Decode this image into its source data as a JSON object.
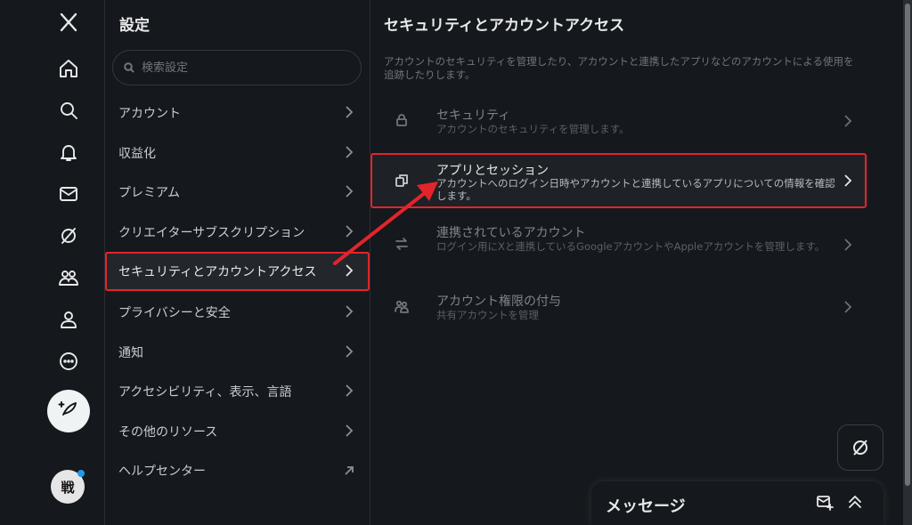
{
  "icons": {
    "logo": "x-logo-icon",
    "nav": [
      "home-icon",
      "search-icon",
      "bell-icon",
      "mail-icon",
      "grok-icon",
      "communities-icon",
      "profile-icon",
      "more-icon"
    ],
    "post": "compose-post-icon"
  },
  "avatar": {
    "text": "戦"
  },
  "settings": {
    "title": "設定",
    "search_placeholder": "検索設定",
    "items": [
      {
        "label": "アカウント"
      },
      {
        "label": "収益化"
      },
      {
        "label": "プレミアム"
      },
      {
        "label": "クリエイターサブスクリプション"
      },
      {
        "label": "セキュリティとアカウントアクセス",
        "active": true
      },
      {
        "label": "プライバシーと安全"
      },
      {
        "label": "通知"
      },
      {
        "label": "アクセシビリティ、表示、言語"
      },
      {
        "label": "その他のリソース"
      },
      {
        "label": "ヘルプセンター",
        "external": true
      }
    ]
  },
  "detail": {
    "title": "セキュリティとアカウントアクセス",
    "description": "アカウントのセキュリティを管理したり、アカウントと連携したアプリなどのアカウントによる使用を追跡したりします。",
    "options": [
      {
        "icon": "lock-icon",
        "title": "セキュリティ",
        "subtitle": "アカウントのセキュリティを管理します。"
      },
      {
        "icon": "apps-icon",
        "title": "アプリとセッション",
        "subtitle": "アカウントへのログイン日時やアカウントと連携しているアプリについての情報を確認します。",
        "active": true
      },
      {
        "icon": "swap-arrows-icon",
        "title": "連携されているアカウント",
        "subtitle": "ログイン用にXと連携しているGoogleアカウントやAppleアカウントを管理します。"
      },
      {
        "icon": "delegate-icon",
        "title": "アカウント権限の付与",
        "subtitle": "共有アカウントを管理"
      }
    ]
  },
  "messages": {
    "title": "メッセージ"
  },
  "colors": {
    "background": "#15181c",
    "highlight": "#e3242b",
    "text": "#e7e9ea",
    "muted": "#71767b"
  }
}
